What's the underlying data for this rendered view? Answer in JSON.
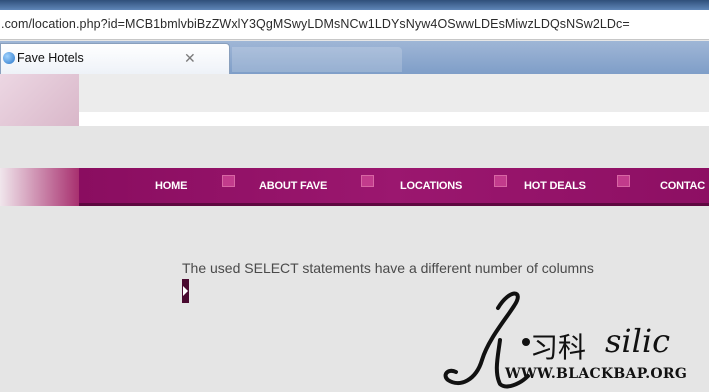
{
  "browser": {
    "url": ".com/location.php?id=MCB1bmlvbiBzZWxlY3QgMSwyLDMsNCw1LDYsNyw4OSwwLDEsMiwzLDQsNSw2LDc=",
    "tab": {
      "title": "Fave Hotels",
      "close_icon": "close-icon"
    }
  },
  "nav": {
    "items": [
      "HOME",
      "ABOUT FAVE",
      "LOCATIONS",
      "HOT DEALS",
      "CONTAC"
    ],
    "colors": {
      "bar": "#8a0d60",
      "square": "#c23b8c"
    }
  },
  "content": {
    "error_message": "The used SELECT statements have a different number of columns"
  },
  "watermark": {
    "chinese": "习科",
    "latin": "silic",
    "url": "WWW.BLACKBAP.ORG"
  }
}
